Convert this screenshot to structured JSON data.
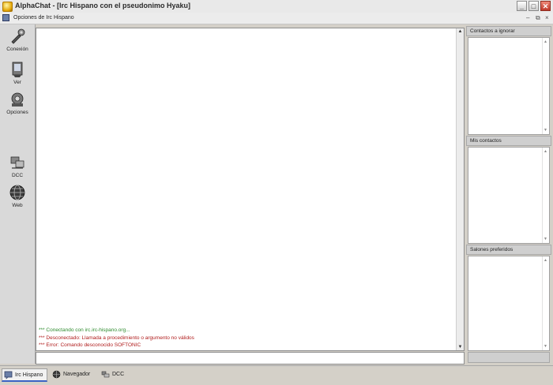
{
  "window": {
    "title": "AlphaChat - [Irc Hispano con el pseudonimo Hyaku]",
    "minimize_label": "_",
    "maximize_label": "□",
    "close_label": "✕"
  },
  "menubar": {
    "label": "Opciones de Irc Hispano",
    "mdi_minimize": "–",
    "mdi_restore": "⧉",
    "mdi_close": "×"
  },
  "sidebar": {
    "items": [
      {
        "label": "Conexión",
        "icon": "wrench-icon"
      },
      {
        "label": "Ver",
        "icon": "view-icon"
      },
      {
        "label": "Opciones",
        "icon": "settings-icon"
      },
      {
        "label": "DCC",
        "icon": "dcc-icon"
      },
      {
        "label": "Web",
        "icon": "globe-icon"
      }
    ]
  },
  "chat": {
    "messages": [
      {
        "text": "*** Conectando con irc.irc-hispano.org...",
        "type": "ok",
        "color": "#2e8b2e"
      },
      {
        "text": "*** Desconectado: Llamada a procedimiento o argumento no válidos",
        "type": "err",
        "color": "#b01c1c"
      },
      {
        "text": "*** Error: Comando desconocido SOFTONIC",
        "type": "err",
        "color": "#b01c1c"
      }
    ],
    "input_value": ""
  },
  "right_panels": [
    {
      "title": "Contactos a ignorar"
    },
    {
      "title": "Mis contactos"
    },
    {
      "title": "Salones preferidos"
    }
  ],
  "taskbar": {
    "tabs": [
      {
        "label": "Irc Hispano",
        "active": true,
        "icon": "chat-icon"
      },
      {
        "label": "Navegador",
        "active": false,
        "icon": "browser-icon"
      },
      {
        "label": "DCC",
        "active": false,
        "icon": "dcc-icon"
      }
    ]
  }
}
